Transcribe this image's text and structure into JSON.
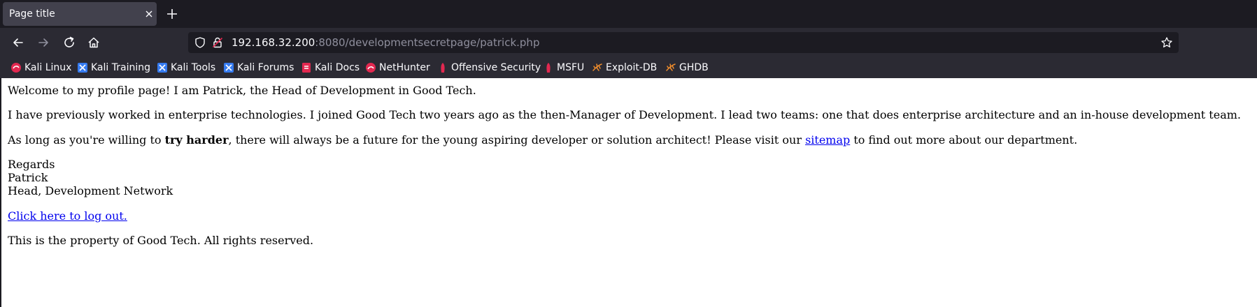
{
  "browser": {
    "tab": {
      "title": "Page title",
      "close_icon": "close-icon"
    },
    "new_tab_icon": "plus-icon",
    "nav": {
      "back_icon": "arrow-left-icon",
      "forward_icon": "arrow-right-icon",
      "reload_icon": "reload-icon",
      "home_icon": "home-icon"
    },
    "url": {
      "host": "192.168.32.200",
      "rest": ":8080/developmentsecretpage/patrick.php",
      "shield_icon": "shield-icon",
      "lock_icon": "insecure-lock-icon",
      "star_icon": "star-icon"
    },
    "bookmarks": [
      {
        "label": "Kali Linux",
        "icon": "kali-icon"
      },
      {
        "label": "Kali Training",
        "icon": "kali-training-icon"
      },
      {
        "label": "Kali Tools",
        "icon": "kali-tools-icon"
      },
      {
        "label": "Kali Forums",
        "icon": "kali-forums-icon"
      },
      {
        "label": "Kali Docs",
        "icon": "kali-docs-icon"
      },
      {
        "label": "NetHunter",
        "icon": "nethunter-icon"
      },
      {
        "label": "Offensive Security",
        "icon": "offsec-icon"
      },
      {
        "label": "MSFU",
        "icon": "msfu-icon"
      },
      {
        "label": "Exploit-DB",
        "icon": "exploit-db-icon"
      },
      {
        "label": "GHDB",
        "icon": "ghdb-icon"
      }
    ]
  },
  "page": {
    "welcome": "Welcome to my profile page! I am Patrick, the Head of Development in Good Tech.",
    "background": "I have previously worked in enterprise technologies. I joined Good Tech two years ago as the then-Manager of Development. I lead two teams: one that does enterprise architecture and an in-house development team.",
    "encourage_before": "As long as you're willing to ",
    "encourage_bold": "try harder",
    "encourage_middle": ", there will always be a future for the young aspiring developer or solution architect! Please visit our ",
    "sitemap_link": "sitemap",
    "encourage_after": " to find out more about our department.",
    "signature": {
      "regards": "Regards",
      "name": "Patrick",
      "role": "Head, Development Network"
    },
    "logout_link": "Click here to log out.",
    "footer": "This is the property of Good Tech. All rights reserved."
  },
  "colors": {
    "tab_bg": "#42414d",
    "toolbar_bg": "#2b2a33",
    "frame_bg": "#1c1b22",
    "link": "#0000ee"
  }
}
